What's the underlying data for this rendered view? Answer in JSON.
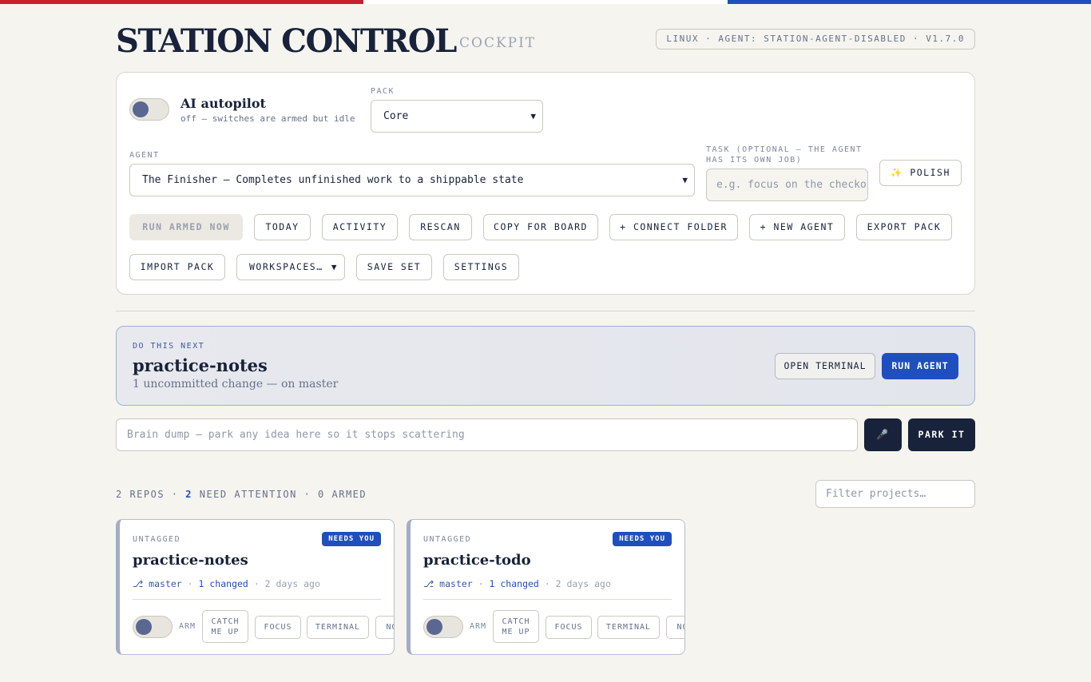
{
  "colors": {
    "flag_red": "#c8202f",
    "flag_white": "#ffffff",
    "flag_blue": "#1f4fbf",
    "accent": "#1f4fbf",
    "ink": "#18223a"
  },
  "header": {
    "title": "STATION CONTROL",
    "subtitle": "COCKPIT",
    "system_badge": "LINUX · AGENT: STATION-AGENT-DISABLED · V1.7.0"
  },
  "autopilot": {
    "title": "AI autopilot",
    "status": "off — switches are armed but idle",
    "enabled": false
  },
  "pack": {
    "label": "PACK",
    "selected": "Core"
  },
  "agent": {
    "label": "AGENT",
    "selected": "The Finisher — Completes unfinished work to a shippable state"
  },
  "task": {
    "label_line1": "TASK (OPTIONAL — THE AGENT",
    "label_line2": "HAS ITS OWN JOB)",
    "placeholder": "e.g. focus on the checkout"
  },
  "polish_button": "✨ POLISH",
  "toolbar": {
    "run_armed": "RUN ARMED NOW",
    "today": "TODAY",
    "activity": "ACTIVITY",
    "rescan": "RESCAN",
    "copy_for_board": "COPY FOR BOARD",
    "connect_folder": "+ CONNECT FOLDER",
    "new_agent": "+ NEW AGENT",
    "export_pack": "EXPORT PACK",
    "import_pack": "IMPORT PACK",
    "workspaces": "WORKSPACES…",
    "save_set": "SAVE SET",
    "settings": "SETTINGS"
  },
  "next_up": {
    "label": "DO THIS NEXT",
    "repo": "practice-notes",
    "detail": "1 uncommitted change — on master",
    "open_terminal": "OPEN TERMINAL",
    "run_agent": "RUN AGENT"
  },
  "brain_dump": {
    "placeholder": "Brain dump — park any idea here so it stops scattering",
    "mic_icon": "🎤",
    "park_button": "PARK IT"
  },
  "summary": {
    "repos": "2 REPOS ·",
    "attention_count": "2",
    "attention_label": "NEED ATTENTION · 0 ARMED"
  },
  "filter": {
    "placeholder": "Filter projects…"
  },
  "cards": [
    {
      "tag": "UNTAGGED",
      "badge": "NEEDS YOU",
      "name": "practice-notes",
      "branch": "⎇ master",
      "sep1": "·",
      "changed": "1 changed",
      "age": "· 2 days ago",
      "arm_label": "ARM",
      "catch_up": "CATCH\nME UP",
      "focus": "FOCUS",
      "terminal": "TERMINAL",
      "notes": "NOTES"
    },
    {
      "tag": "UNTAGGED",
      "badge": "NEEDS YOU",
      "name": "practice-todo",
      "branch": "⎇ master",
      "sep1": "·",
      "changed": "1 changed",
      "age": "· 2 days ago",
      "arm_label": "ARM",
      "catch_up": "CATCH\nME UP",
      "focus": "FOCUS",
      "terminal": "TERMINAL",
      "notes": "NOTES"
    }
  ]
}
